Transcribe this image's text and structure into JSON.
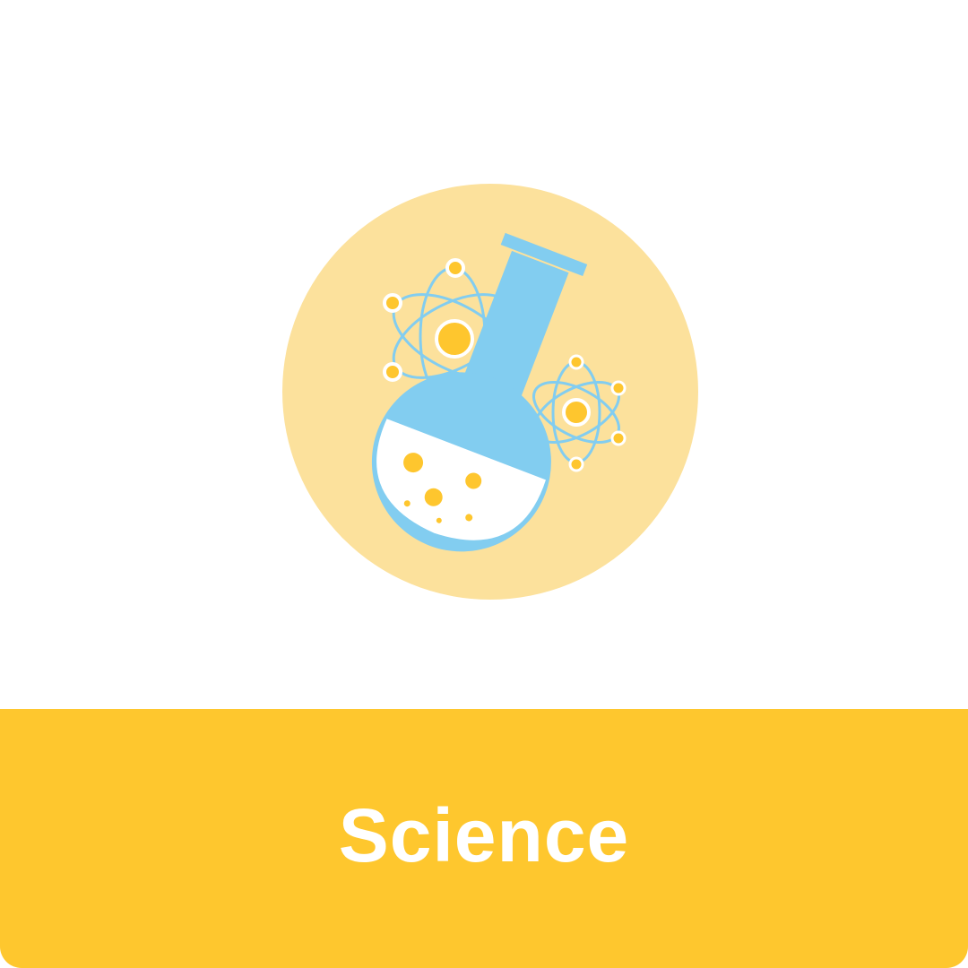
{
  "card": {
    "label": "Science",
    "icon": "science-flask-atom-icon"
  },
  "colors": {
    "circle": "#FCE19C",
    "flask": "#82CDF0",
    "accent": "#FEC62E",
    "label_bar": "#FEC72E",
    "label_text": "#FFFFFF",
    "background": "#FFFFFF"
  }
}
